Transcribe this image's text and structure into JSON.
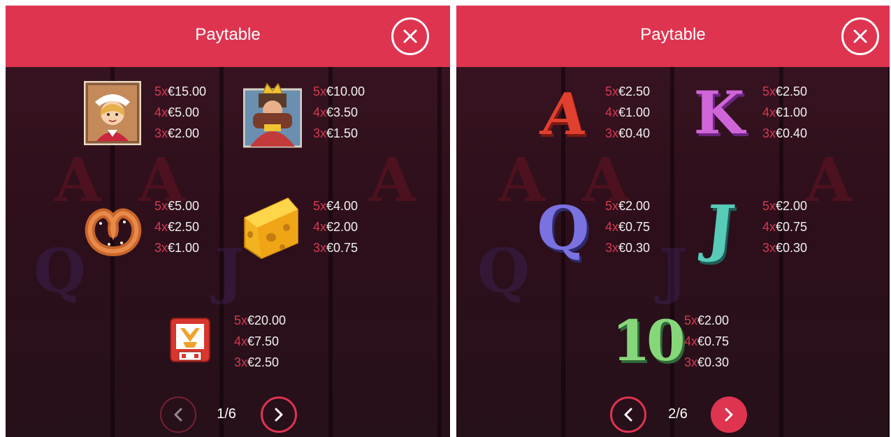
{
  "panels": [
    {
      "title": "Paytable",
      "page": "1/6",
      "symbols": [
        {
          "icon": "waitress-portrait-icon",
          "payouts": [
            {
              "mult": "5x",
              "amount": "€15.00"
            },
            {
              "mult": "4x",
              "amount": "€5.00"
            },
            {
              "mult": "3x",
              "amount": "€2.00"
            }
          ]
        },
        {
          "icon": "king-portrait-icon",
          "payouts": [
            {
              "mult": "5x",
              "amount": "€10.00"
            },
            {
              "mult": "4x",
              "amount": "€3.50"
            },
            {
              "mult": "3x",
              "amount": "€1.50"
            }
          ]
        },
        {
          "icon": "pretzel-icon",
          "payouts": [
            {
              "mult": "5x",
              "amount": "€5.00"
            },
            {
              "mult": "4x",
              "amount": "€2.50"
            },
            {
              "mult": "3x",
              "amount": "€1.00"
            }
          ]
        },
        {
          "icon": "cheese-icon",
          "payouts": [
            {
              "mult": "5x",
              "amount": "€4.00"
            },
            {
              "mult": "4x",
              "amount": "€2.00"
            },
            {
              "mult": "3x",
              "amount": "€0.75"
            }
          ]
        },
        {
          "icon": "beer-crest-icon",
          "payouts": [
            {
              "mult": "5x",
              "amount": "€20.00"
            },
            {
              "mult": "4x",
              "amount": "€7.50"
            },
            {
              "mult": "3x",
              "amount": "€2.50"
            }
          ]
        }
      ]
    },
    {
      "title": "Paytable",
      "page": "2/6",
      "symbols": [
        {
          "icon": "letter-a-icon",
          "glyph": "A",
          "payouts": [
            {
              "mult": "5x",
              "amount": "€2.50"
            },
            {
              "mult": "4x",
              "amount": "€1.00"
            },
            {
              "mult": "3x",
              "amount": "€0.40"
            }
          ]
        },
        {
          "icon": "letter-k-icon",
          "glyph": "K",
          "payouts": [
            {
              "mult": "5x",
              "amount": "€2.50"
            },
            {
              "mult": "4x",
              "amount": "€1.00"
            },
            {
              "mult": "3x",
              "amount": "€0.40"
            }
          ]
        },
        {
          "icon": "letter-q-icon",
          "glyph": "Q",
          "payouts": [
            {
              "mult": "5x",
              "amount": "€2.00"
            },
            {
              "mult": "4x",
              "amount": "€0.75"
            },
            {
              "mult": "3x",
              "amount": "€0.30"
            }
          ]
        },
        {
          "icon": "letter-j-icon",
          "glyph": "J",
          "payouts": [
            {
              "mult": "5x",
              "amount": "€2.00"
            },
            {
              "mult": "4x",
              "amount": "€0.75"
            },
            {
              "mult": "3x",
              "amount": "€0.30"
            }
          ]
        },
        {
          "icon": "number-10-icon",
          "glyph": "10",
          "payouts": [
            {
              "mult": "5x",
              "amount": "€2.00"
            },
            {
              "mult": "4x",
              "amount": "€0.75"
            },
            {
              "mult": "3x",
              "amount": "€0.30"
            }
          ]
        }
      ]
    }
  ],
  "colors": {
    "header": "#de3450",
    "multiplier": "#d43a52",
    "background": "#2e0f1b",
    "letter_a": "#e2402f",
    "letter_k": "#d065d8",
    "letter_q": "#7a72e0",
    "letter_j": "#57cbb8",
    "number_10": "#86d77a"
  }
}
